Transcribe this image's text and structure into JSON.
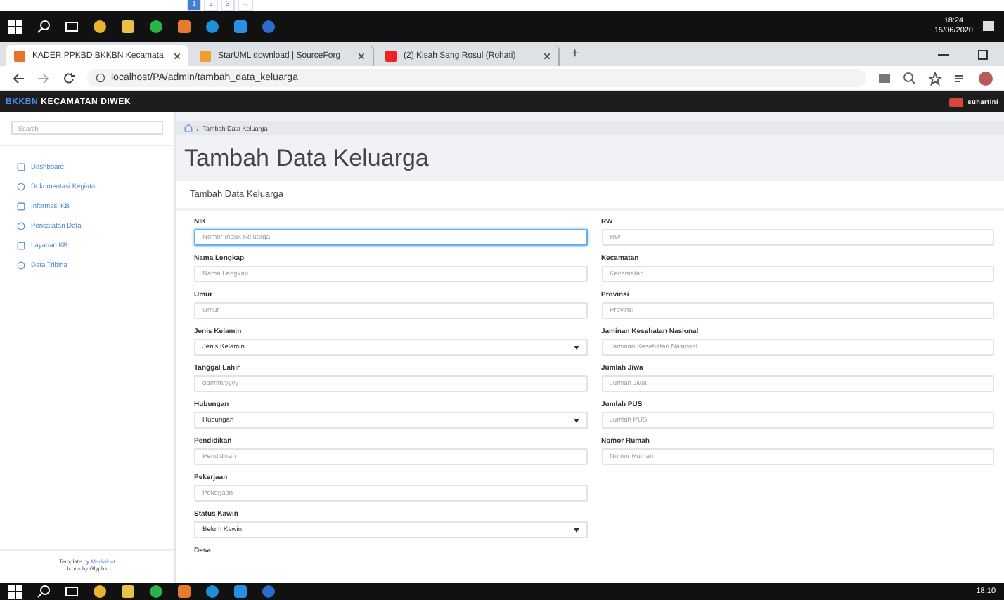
{
  "pagination": [
    {
      "label": "1",
      "selected": true
    },
    {
      "label": "2",
      "selected": false
    },
    {
      "label": "3",
      "selected": false
    },
    {
      "label": "→",
      "selected": false
    }
  ],
  "top_taskbar": {
    "time": "18:24",
    "date": "15/06/2020"
  },
  "browser": {
    "tabs": [
      {
        "title": "KADER PPKBD BKKBN Kecamata",
        "selected": true
      },
      {
        "title": "StarUML download | SourceForg",
        "selected": false
      },
      {
        "title": "(2) Kisah Sang Rosul (Rohati)",
        "selected": false
      }
    ],
    "new_tab": "+",
    "address": "localhost/PA/admin/tambah_data_keluarga"
  },
  "navbar": {
    "brand_prefix": "BKKBN",
    "brand": "KECAMATAN DIWEK",
    "user": "suhartini"
  },
  "sidebar": {
    "search_placeholder": "Search",
    "items": [
      {
        "label": "Dashboard"
      },
      {
        "label": "Dokumentasi Kegiatan"
      },
      {
        "label": "Informasi KB"
      },
      {
        "label": "Pencatatan Data"
      },
      {
        "label": "Layanan KB"
      },
      {
        "label": "Data Tribina"
      }
    ],
    "footer": [
      {
        "text": "Template by ",
        "link": "Medialoot"
      },
      {
        "text": "Icons by Glyphs"
      }
    ]
  },
  "breadcrumb_separator": "/",
  "breadcrumb": "Tambah Data Keluarga",
  "title": "Tambah Data Keluarga",
  "form": {
    "header": "Tambah Data Keluarga",
    "left": [
      {
        "kind": "input",
        "label": "NIK",
        "placeholder": "Nomor Induk Keluarga",
        "focused": true
      },
      {
        "kind": "input",
        "label": "Nama Lengkap",
        "placeholder": "Nama Lengkap",
        "focused": false
      },
      {
        "kind": "input",
        "label": "Umur",
        "placeholder": "Umur",
        "focused": false
      },
      {
        "kind": "select",
        "label": "Jenis Kelamin",
        "value": "Jenis Kelamin",
        "focused": false
      },
      {
        "kind": "input",
        "label": "Tanggal Lahir",
        "placeholder": "dd/mm/yyyy",
        "focused": false
      },
      {
        "kind": "select",
        "label": "Hubungan",
        "value": "Hubungan",
        "focused": false
      },
      {
        "kind": "input",
        "label": "Pendidikan",
        "placeholder": "Pendidikan",
        "focused": false
      },
      {
        "kind": "input",
        "label": "Pekerjaan",
        "placeholder": "Pekerjaan",
        "focused": false
      },
      {
        "kind": "select",
        "label": "Status Kawin",
        "value": "Belum Kawin",
        "focused": false
      },
      {
        "kind": "label",
        "label": "Desa"
      }
    ],
    "right": [
      {
        "kind": "input",
        "label": "RW",
        "placeholder": "RW",
        "focused": false
      },
      {
        "kind": "input",
        "label": "Kecamatan",
        "placeholder": "Kecamatan",
        "focused": false
      },
      {
        "kind": "input",
        "label": "Provinsi",
        "placeholder": "Provinsi",
        "focused": false
      },
      {
        "kind": "input",
        "label": "Jaminan Kesehatan Nasional",
        "placeholder": "Jaminan Kesehatan Nasional",
        "focused": false
      },
      {
        "kind": "input",
        "label": "Jumlah Jiwa",
        "placeholder": "Jumlah Jiwa",
        "focused": false
      },
      {
        "kind": "input",
        "label": "Jumlah PUS",
        "placeholder": "Jumlah PUS",
        "focused": false
      },
      {
        "kind": "input",
        "label": "Nomor Rumah",
        "placeholder": "Nomor Rumah",
        "focused": false
      }
    ]
  },
  "bottom_taskbar": {
    "time": "18:10"
  }
}
